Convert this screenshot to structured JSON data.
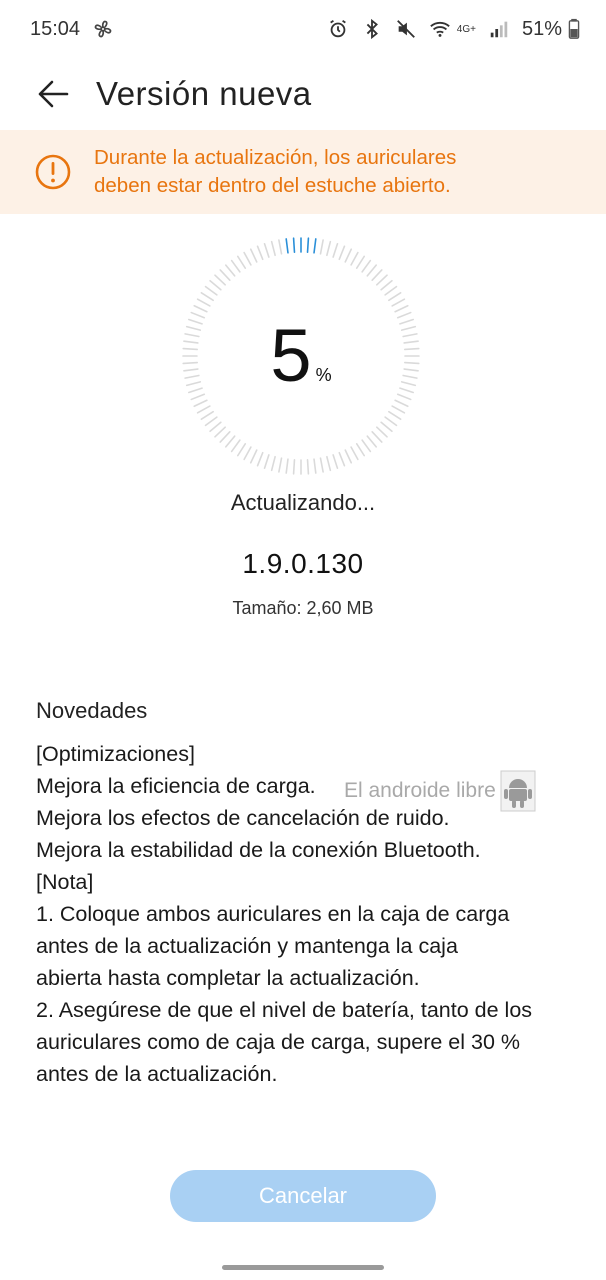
{
  "status_bar": {
    "time": "15:04",
    "network_label": "4G+",
    "battery_percent": "51%",
    "icons": [
      "fan-icon",
      "alarm-icon",
      "bluetooth-icon",
      "mute-icon",
      "wifi-icon",
      "signal-icon",
      "battery-icon"
    ]
  },
  "header": {
    "title": "Versión nueva",
    "back_icon": "back-arrow-icon"
  },
  "warning": {
    "icon": "warning-icon",
    "text": "Durante la actualización, los auriculares\ndeben estar dentro del estuche abierto.",
    "color": "#e8750f",
    "background": "#fdf1e6"
  },
  "progress": {
    "value": "5",
    "unit": "%",
    "fraction": 0.05,
    "accent_color": "#2a8fd8"
  },
  "update": {
    "status": "Actualizando...",
    "version": "1.9.0.130",
    "size": "Tamaño: 2,60 MB"
  },
  "notes": {
    "heading": "Novedades",
    "lines": [
      "[Optimizaciones]",
      "Mejora la eficiencia de carga.",
      "Mejora los efectos de cancelación de ruido.",
      "Mejora la estabilidad de la conexión Bluetooth.",
      "[Nota]",
      "1. Coloque ambos auriculares en la caja de carga",
      "antes de la actualización y mantenga la caja",
      "abierta hasta completar la actualización.",
      "2. Asegúrese de que el nivel de batería, tanto de los",
      "auriculares como de caja de carga, supere el 30 %",
      "antes de la actualización."
    ]
  },
  "watermark": {
    "text": "El androide libre"
  },
  "actions": {
    "cancel_label": "Cancelar",
    "cancel_color": "#a9d0f3"
  }
}
